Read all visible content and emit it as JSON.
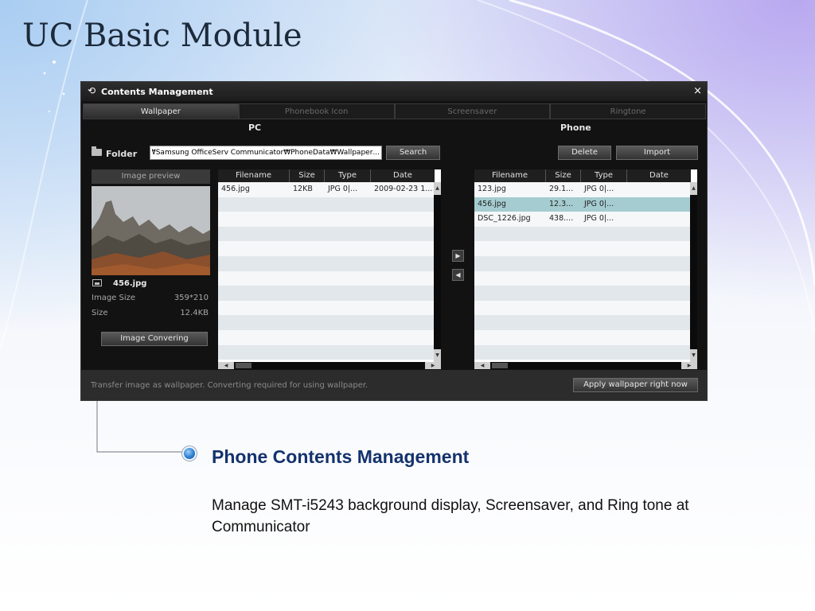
{
  "slide": {
    "title": "UC Basic Module",
    "heading": "Phone Contents Management",
    "description": "Manage SMT-i5243  background display, Screensaver, and Ring tone at Communicator"
  },
  "window": {
    "title": "Contents Management",
    "close_glyph": "×",
    "title_icon": "refresh-icon",
    "tabs": [
      {
        "label": "Wallpaper",
        "active": true
      },
      {
        "label": "Phonebook Icon",
        "active": false
      },
      {
        "label": "Screensaver",
        "active": false
      },
      {
        "label": "Ringtone",
        "active": false
      }
    ],
    "pc": {
      "section_label": "PC",
      "folder_label": "Folder",
      "path_value": "...nics₩Samsung OfficeServ Communicator₩PhoneData₩Wallpaper",
      "search_label": "Search",
      "preview_label": "Image preview",
      "file_name": "456.jpg",
      "image_size_label": "Image Size",
      "image_size_value": "359*210",
      "size_label": "Size",
      "size_value": "12.4KB",
      "convert_label": "Image Convering",
      "columns": [
        "Filename",
        "Size",
        "Type",
        "Date"
      ],
      "rows": [
        {
          "filename": "456.jpg",
          "size": "12KB",
          "type": "JPG 0|...",
          "date": "2009-02-23 1..."
        }
      ]
    },
    "phone": {
      "section_label": "Phone",
      "delete_label": "Delete",
      "import_label": "Import",
      "columns": [
        "Filename",
        "Size",
        "Type",
        "Date"
      ],
      "rows": [
        {
          "filename": "123.jpg",
          "size": "29.1...",
          "type": "JPG 0|...",
          "date": ""
        },
        {
          "filename": "456.jpg",
          "size": "12.3...",
          "type": "JPG 0|...",
          "date": "",
          "selected": true
        },
        {
          "filename": "DSC_1226.jpg",
          "size": "438....",
          "type": "JPG 0|...",
          "date": ""
        }
      ]
    },
    "transfer_right_glyph": "▶",
    "transfer_left_glyph": "◀",
    "footer_message": "Transfer image as wallpaper. Converting required for using wallpaper.",
    "apply_label": "Apply wallpaper right now",
    "colors": {
      "window_bg": "#121212",
      "selected_row": "#a5ccd0",
      "heading": "#14326e"
    }
  }
}
